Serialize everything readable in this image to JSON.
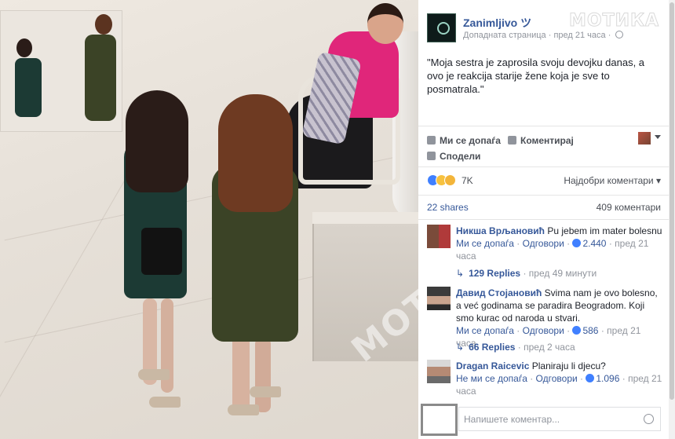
{
  "watermark": {
    "text": "МОТИКА"
  },
  "post": {
    "page_name": "Zanimljivo ツ",
    "page_type": "Допадната страница",
    "separator": "·",
    "time": "пред 21 часа",
    "text": "\"Moja sestra je zaprosila svoju devojku danas, a ovo je reakcija starije žene koja je sve to posmatrala.\""
  },
  "actions": {
    "like": "Ми се допаѓа",
    "comment": "Коментирај",
    "share": "Сподели"
  },
  "reactions": {
    "count": "7K",
    "sort_label": "Најдобри коментари ▾"
  },
  "stats": {
    "shares": "22 shares",
    "comments": "409 коментари"
  },
  "comments": [
    {
      "author": "Никша Врљановић",
      "text": "Pu jebem im mater bolesnu",
      "like": "Ми се допаѓа",
      "reply": "Одговори",
      "likes": "2.440",
      "time": "пред 21 часа",
      "replies": "129 Replies",
      "replies_time": "пред 49 минути"
    },
    {
      "author": "Давид Стојановић",
      "text": "Svima nam je ovo bolesno, a već godinama se paradira Beogradom. Koji smo kurac od naroda u stvari.",
      "like": "Ми се допаѓа",
      "reply": "Одговори",
      "likes": "586",
      "time": "пред 21 часа",
      "replies": "66 Replies",
      "replies_time": "пред 2 часа"
    },
    {
      "author": "Dragan Raicevic",
      "text": "Planiraju li djecu?",
      "like": "Не ми се допаѓа",
      "reply": "Одговори",
      "likes": "1.096",
      "time": "пред 21 часа"
    }
  ],
  "composer": {
    "placeholder": "Напишете коментар..."
  },
  "colors": {
    "link": "#365899",
    "meta": "#90949c",
    "like_blue": "#4080ff"
  },
  "icons": [
    "like-icon",
    "comment-icon",
    "share-icon",
    "globe-icon",
    "smiley-icon",
    "reply-arrow-icon"
  ]
}
